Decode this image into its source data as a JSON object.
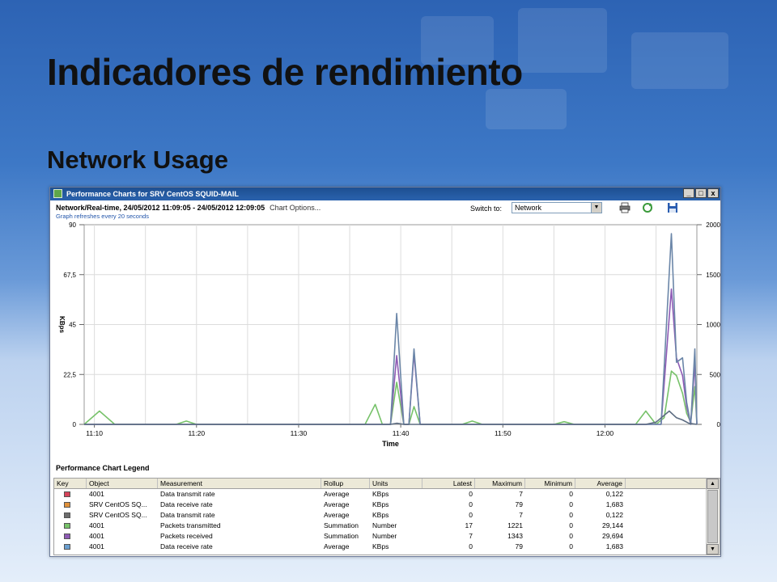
{
  "slide": {
    "title": "Indicadores de rendimiento",
    "subtitle": "Network Usage"
  },
  "window": {
    "title": "Performance Charts for SRV CentOS SQUID-MAIL",
    "min_glyph": "_",
    "max_glyph": "□",
    "close_glyph": "x"
  },
  "header": {
    "range": "Network/Real-time, 24/05/2012 11:09:05 - 24/05/2012 12:09:05",
    "options": "Chart Options...",
    "refresh": "Graph refreshes every 20 seconds",
    "switch_label": "Switch to:",
    "switch_value": "Network"
  },
  "toolbar": {
    "print_icon": "printer-icon",
    "refresh_icon": "refresh-icon",
    "save_icon": "save-icon"
  },
  "chart_data": {
    "type": "line",
    "xlabel": "Time",
    "ylabel_left": "KBps",
    "ylabel_right": "Number",
    "xticks": [
      "11:10",
      "11:20",
      "11:30",
      "11:40",
      "11:50",
      "12:00"
    ],
    "y_left_ticks": [
      "0",
      "22,5",
      "45",
      "67,5",
      "90"
    ],
    "y_right_ticks": [
      "0",
      "500",
      "1000",
      "1500",
      "2000"
    ],
    "ylim_left": [
      0,
      90
    ],
    "ylim_right": [
      0,
      2000
    ],
    "x_range_minutes": [
      9,
      69
    ],
    "grid": true,
    "series": [
      {
        "color": "#77c26a",
        "points": [
          [
            9,
            0
          ],
          [
            10.5,
            6
          ],
          [
            12,
            0
          ],
          [
            18,
            0
          ],
          [
            19,
            1.5
          ],
          [
            20,
            0
          ],
          [
            36.5,
            0
          ],
          [
            37.5,
            9
          ],
          [
            38.2,
            0
          ],
          [
            39,
            0
          ],
          [
            39.6,
            19
          ],
          [
            40.3,
            0
          ],
          [
            40.8,
            0
          ],
          [
            41.3,
            8
          ],
          [
            41.9,
            0
          ],
          [
            46,
            0
          ],
          [
            47,
            1.5
          ],
          [
            48,
            0
          ],
          [
            55,
            0
          ],
          [
            56,
            1.2
          ],
          [
            57,
            0
          ],
          [
            63,
            0
          ],
          [
            64,
            6
          ],
          [
            65,
            0
          ],
          [
            65.8,
            3
          ],
          [
            66.5,
            24
          ],
          [
            67,
            22
          ],
          [
            67.6,
            14
          ],
          [
            68,
            5
          ],
          [
            68.4,
            1
          ],
          [
            68.8,
            17
          ],
          [
            69,
            0
          ]
        ]
      },
      {
        "color": "#8e5bb5",
        "points": [
          [
            9,
            0
          ],
          [
            39,
            0
          ],
          [
            39.6,
            31
          ],
          [
            40.3,
            0
          ],
          [
            40.8,
            0
          ],
          [
            41.3,
            32
          ],
          [
            41.9,
            0
          ],
          [
            65.5,
            0
          ],
          [
            66.5,
            61
          ],
          [
            67,
            30
          ],
          [
            67.6,
            22
          ],
          [
            68,
            8
          ],
          [
            68.4,
            0
          ],
          [
            68.8,
            28
          ],
          [
            69,
            0
          ]
        ]
      },
      {
        "color": "#6b86a8",
        "points": [
          [
            9,
            0
          ],
          [
            39,
            0
          ],
          [
            39.6,
            50
          ],
          [
            40.3,
            0
          ],
          [
            40.8,
            0
          ],
          [
            41.3,
            34
          ],
          [
            41.9,
            0
          ],
          [
            65.5,
            0
          ],
          [
            66.5,
            86
          ],
          [
            67,
            28
          ],
          [
            67.6,
            30
          ],
          [
            68,
            10
          ],
          [
            68.4,
            0
          ],
          [
            68.8,
            34
          ],
          [
            69,
            0
          ]
        ]
      },
      {
        "color": "#5b6b80",
        "points": [
          [
            9,
            0
          ],
          [
            39,
            0
          ],
          [
            39.6,
            0.5
          ],
          [
            40.3,
            0
          ],
          [
            64,
            0
          ],
          [
            65,
            1
          ],
          [
            66.3,
            6
          ],
          [
            67,
            3
          ],
          [
            67.6,
            2
          ],
          [
            68.2,
            0.5
          ],
          [
            69,
            0
          ]
        ]
      }
    ]
  },
  "legend": {
    "title": "Performance Chart Legend",
    "headers": [
      "Key",
      "Object",
      "Measurement",
      "Rollup",
      "Units",
      "Latest",
      "Maximum",
      "Minimum",
      "Average"
    ],
    "rows": [
      {
        "color": "#d6435a",
        "object": "4001",
        "measurement": "Data transmit rate",
        "rollup": "Average",
        "units": "KBps",
        "latest": "0",
        "maximum": "7",
        "minimum": "0",
        "average": "0,122"
      },
      {
        "color": "#e0913a",
        "object": "SRV CentOS SQ...",
        "measurement": "Data receive rate",
        "rollup": "Average",
        "units": "KBps",
        "latest": "0",
        "maximum": "79",
        "minimum": "0",
        "average": "1,683"
      },
      {
        "color": "#6d6d6d",
        "object": "SRV CentOS SQ...",
        "measurement": "Data transmit rate",
        "rollup": "Average",
        "units": "KBps",
        "latest": "0",
        "maximum": "7",
        "minimum": "0",
        "average": "0,122"
      },
      {
        "color": "#77c26a",
        "object": "4001",
        "measurement": "Packets transmitted",
        "rollup": "Summation",
        "units": "Number",
        "latest": "17",
        "maximum": "1221",
        "minimum": "0",
        "average": "29,144"
      },
      {
        "color": "#8e5bb5",
        "object": "4001",
        "measurement": "Packets received",
        "rollup": "Summation",
        "units": "Number",
        "latest": "7",
        "maximum": "1343",
        "minimum": "0",
        "average": "29,694"
      },
      {
        "color": "#6a9fd0",
        "object": "4001",
        "measurement": "Data receive rate",
        "rollup": "Average",
        "units": "KBps",
        "latest": "0",
        "maximum": "79",
        "minimum": "0",
        "average": "1,683"
      }
    ]
  }
}
